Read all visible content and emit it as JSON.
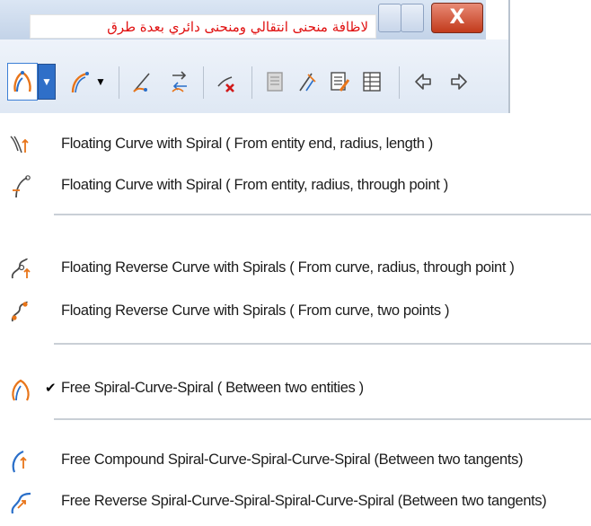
{
  "window": {
    "note_text": "لاظافة منحنى انتقالي ومنحنى دائري بعدة طرق",
    "close_label": "X"
  },
  "toolbar": {
    "buttons": [
      {
        "name": "free-spiral-curve-spiral",
        "icon": "spiral-curve-icon",
        "has_dropdown": true,
        "active": true
      },
      {
        "name": "floating-curve-spiral",
        "icon": "floating-curve-icon",
        "has_dropdown": true
      },
      {
        "name": "curve-through-points",
        "icon": "curve-points-icon"
      },
      {
        "name": "reverse-arrows",
        "icon": "reverse-arrows-icon"
      },
      {
        "name": "delete-curve",
        "icon": "delete-curve-icon"
      },
      {
        "name": "properties",
        "icon": "properties-icon"
      },
      {
        "name": "edit-geometry",
        "icon": "edit-geometry-icon"
      },
      {
        "name": "edit-table",
        "icon": "edit-table-icon"
      },
      {
        "name": "table",
        "icon": "table-icon"
      },
      {
        "name": "undo",
        "icon": "undo-icon"
      },
      {
        "name": "redo",
        "icon": "redo-icon"
      }
    ]
  },
  "menu": {
    "items": [
      {
        "label": "Floating Curve with Spiral ( From entity end, radius, length )",
        "icon": "curve-spiral-end-icon",
        "checked": false
      },
      {
        "label": "Floating Curve with Spiral ( From entity, radius, through point )",
        "icon": "curve-spiral-point-icon",
        "checked": false
      },
      {
        "label": "Floating Reverse Curve with Spirals ( From curve, radius, through point )",
        "icon": "reverse-curve-point-icon",
        "checked": false
      },
      {
        "label": "Floating Reverse Curve with Spirals ( From curve, two points )",
        "icon": "reverse-curve-two-points-icon",
        "checked": false
      },
      {
        "label": "Free Spiral-Curve-Spiral ( Between two entities )",
        "icon": "free-spiral-curve-spiral-icon",
        "checked": true,
        "check_mark": "✔"
      },
      {
        "label": "Free Compound Spiral-Curve-Spiral-Curve-Spiral (Between two tangents)",
        "icon": "compound-spiral-icon",
        "checked": false
      },
      {
        "label": "Free Reverse Spiral-Curve-Spiral-Spiral-Curve-Spiral (Between two tangents)",
        "icon": "reverse-spiral-icon",
        "checked": false
      }
    ]
  },
  "colors": {
    "icon_orange": "#e8751a",
    "icon_blue": "#2a6fc9",
    "icon_dark": "#4a4a4a",
    "note_red": "#e01010",
    "close_red": "#c23a1b"
  }
}
